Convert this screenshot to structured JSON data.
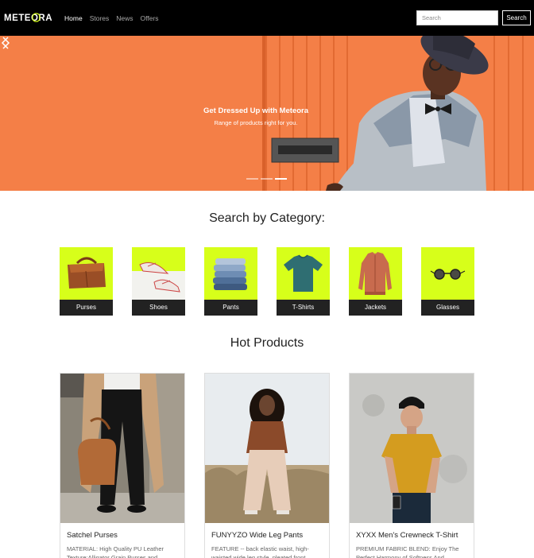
{
  "navbar": {
    "brand": "METEORA",
    "links": [
      {
        "label": "Home",
        "active": true
      },
      {
        "label": "Stores",
        "active": false
      },
      {
        "label": "News",
        "active": false
      },
      {
        "label": "Offers",
        "active": false
      }
    ],
    "search_placeholder": "Search",
    "search_button": "Search"
  },
  "hero": {
    "title": "Get Dressed Up with Meteora",
    "subtitle": "Range of products right for you.",
    "active_slide": 3,
    "slide_count": 3
  },
  "categories": {
    "title": "Search by Category:",
    "items": [
      {
        "label": "Purses"
      },
      {
        "label": "Shoes"
      },
      {
        "label": "Pants"
      },
      {
        "label": "T-Shirts"
      },
      {
        "label": "Jackets"
      },
      {
        "label": "Glasses"
      }
    ]
  },
  "hot_products": {
    "title": "Hot Products",
    "items": [
      {
        "name": "Satchel Purses",
        "description": "MATERIAL: High Quality PU Leather Texture:Alligator Grain Purses and"
      },
      {
        "name": "FUNYYZO Wide Leg Pants",
        "description": "FEATURE -- back elastic waist, high-waisted wide leg style, pleated front"
      },
      {
        "name": "XYXX Men's Crewneck T-Shirt",
        "description": "PREMIUM FABRIC BLEND: Enjoy The Perfect Harmony of Softness And"
      }
    ]
  },
  "colors": {
    "navbar_bg": "#000000",
    "hero_bg": "#f47f47",
    "category_bg": "#d7ff1a",
    "category_label_bg": "#222222"
  }
}
